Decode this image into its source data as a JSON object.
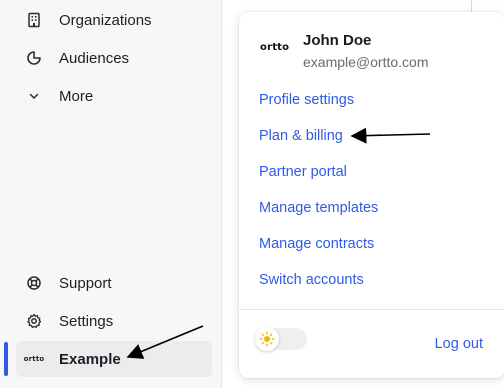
{
  "sidebar": {
    "items": [
      {
        "label": "Organizations",
        "icon": "building-icon"
      },
      {
        "label": "Audiences",
        "icon": "pie-chart-icon"
      },
      {
        "label": "More",
        "icon": "chevron-down-icon"
      }
    ],
    "bottom_items": [
      {
        "label": "Support",
        "icon": "lifebuoy-icon"
      },
      {
        "label": "Settings",
        "icon": "gear-icon"
      }
    ],
    "account": {
      "label": "Example",
      "logo_text": "ortto"
    }
  },
  "account_menu": {
    "logo_text": "ortto",
    "user_name": "John Doe",
    "user_email": "example@ortto.com",
    "links": [
      "Profile settings",
      "Plan & billing",
      "Partner portal",
      "Manage templates",
      "Manage contracts",
      "Switch accounts"
    ],
    "theme_toggle_icon": "sun-icon",
    "logout_label": "Log out"
  },
  "colors": {
    "accent": "#2f5be7",
    "sun": "#f5b400",
    "sidebar_bg": "#f7f7f8"
  }
}
